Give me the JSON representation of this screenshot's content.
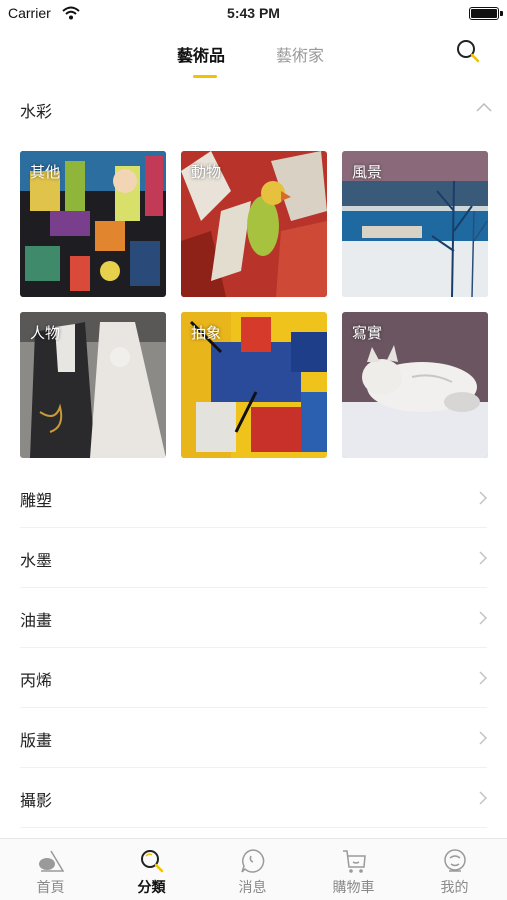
{
  "status_bar": {
    "carrier": "Carrier",
    "time": "5:43 PM",
    "battery_level": 1.0
  },
  "top_tabs": {
    "artworks": "藝術品",
    "artists": "藝術家",
    "active": "artworks"
  },
  "section": {
    "title": "水彩",
    "expanded": true
  },
  "tiles": [
    {
      "label": "其他"
    },
    {
      "label": "動物"
    },
    {
      "label": "風景"
    },
    {
      "label": "人物"
    },
    {
      "label": "抽象"
    },
    {
      "label": "寫實"
    }
  ],
  "categories": [
    {
      "label": "雕塑"
    },
    {
      "label": "水墨"
    },
    {
      "label": "油畫"
    },
    {
      "label": "丙烯"
    },
    {
      "label": "版畫"
    },
    {
      "label": "攝影"
    }
  ],
  "bottom_tabs": [
    {
      "label": "首頁",
      "icon": "home-icon"
    },
    {
      "label": "分類",
      "icon": "category-search-icon",
      "active": true
    },
    {
      "label": "消息",
      "icon": "message-icon"
    },
    {
      "label": "購物車",
      "icon": "cart-icon"
    },
    {
      "label": "我的",
      "icon": "profile-icon"
    }
  ],
  "colors": {
    "accent": "#f2c300",
    "inactive": "#8a8a8a"
  }
}
